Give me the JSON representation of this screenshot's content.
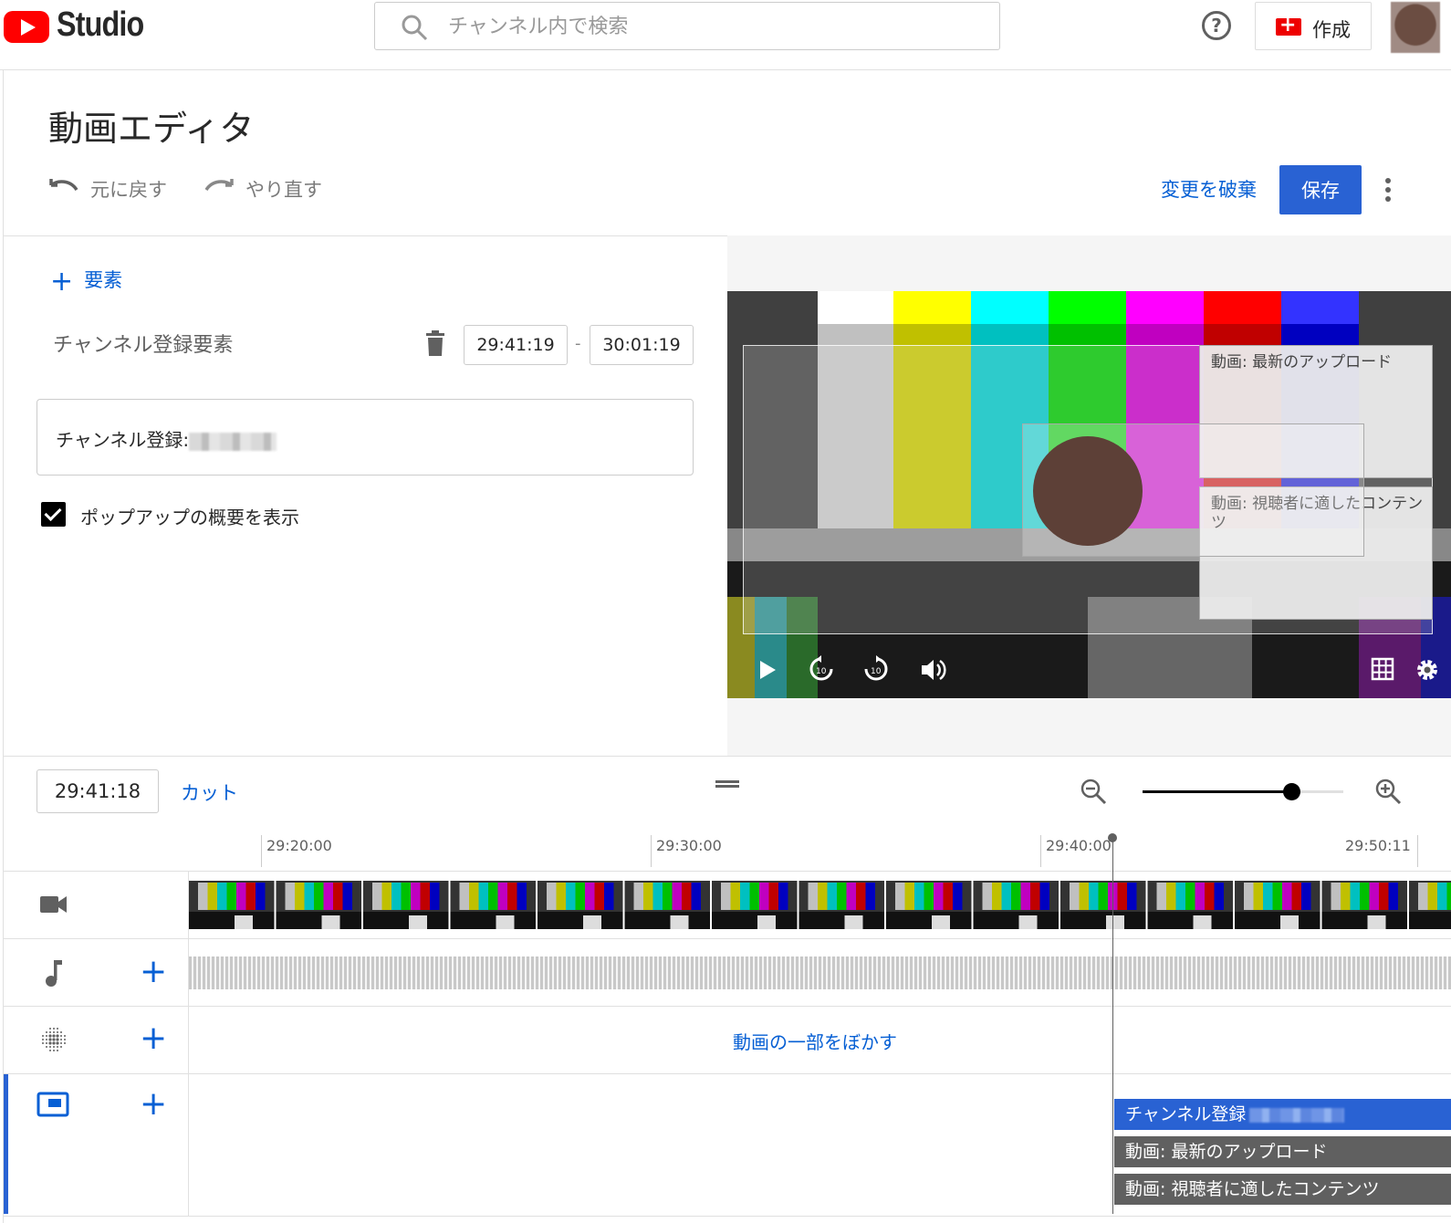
{
  "app": {
    "logo_text": "Studio"
  },
  "search": {
    "placeholder": "チャンネル内で検索"
  },
  "header": {
    "help_icon": "?",
    "create_label": "作成"
  },
  "editor": {
    "title": "動画エディタ",
    "undo_label": "元に戻す",
    "redo_label": "やり直す",
    "discard_label": "変更を破棄",
    "save_label": "保存"
  },
  "element_panel": {
    "add_label": "要素",
    "add_plus": "+",
    "element_name": "チャンネル登録要素",
    "start_time": "29:41:19",
    "time_separator": "-",
    "end_time": "30:01:19",
    "text_value": "チャンネル登録:",
    "checkbox_label": "ポップアップの概要を表示",
    "checkbox_checked": true
  },
  "preview": {
    "card_latest": "動画: 最新のアップロード",
    "card_suited": "動画: 視聴者に適したコンテンツ"
  },
  "timeline": {
    "current_time": "29:41:18",
    "cut_label": "カット",
    "zoom_level": 0.74,
    "ticks": [
      "29:20:00",
      "29:30:00",
      "29:40:00",
      "29:50:11"
    ],
    "blur_link": "動画の一部をぼかす",
    "lane_plus": "+",
    "end_elements": [
      {
        "label": "チャンネル登録",
        "color": "#2962d3"
      },
      {
        "label": "動画: 最新のアップロード",
        "color": "#606060"
      },
      {
        "label": "動画: 視聴者に適したコンテンツ",
        "color": "#606060"
      }
    ]
  },
  "colors": {
    "accent": "#065fd4",
    "brand_red": "#ff0000",
    "save_bg": "#2962d3"
  }
}
